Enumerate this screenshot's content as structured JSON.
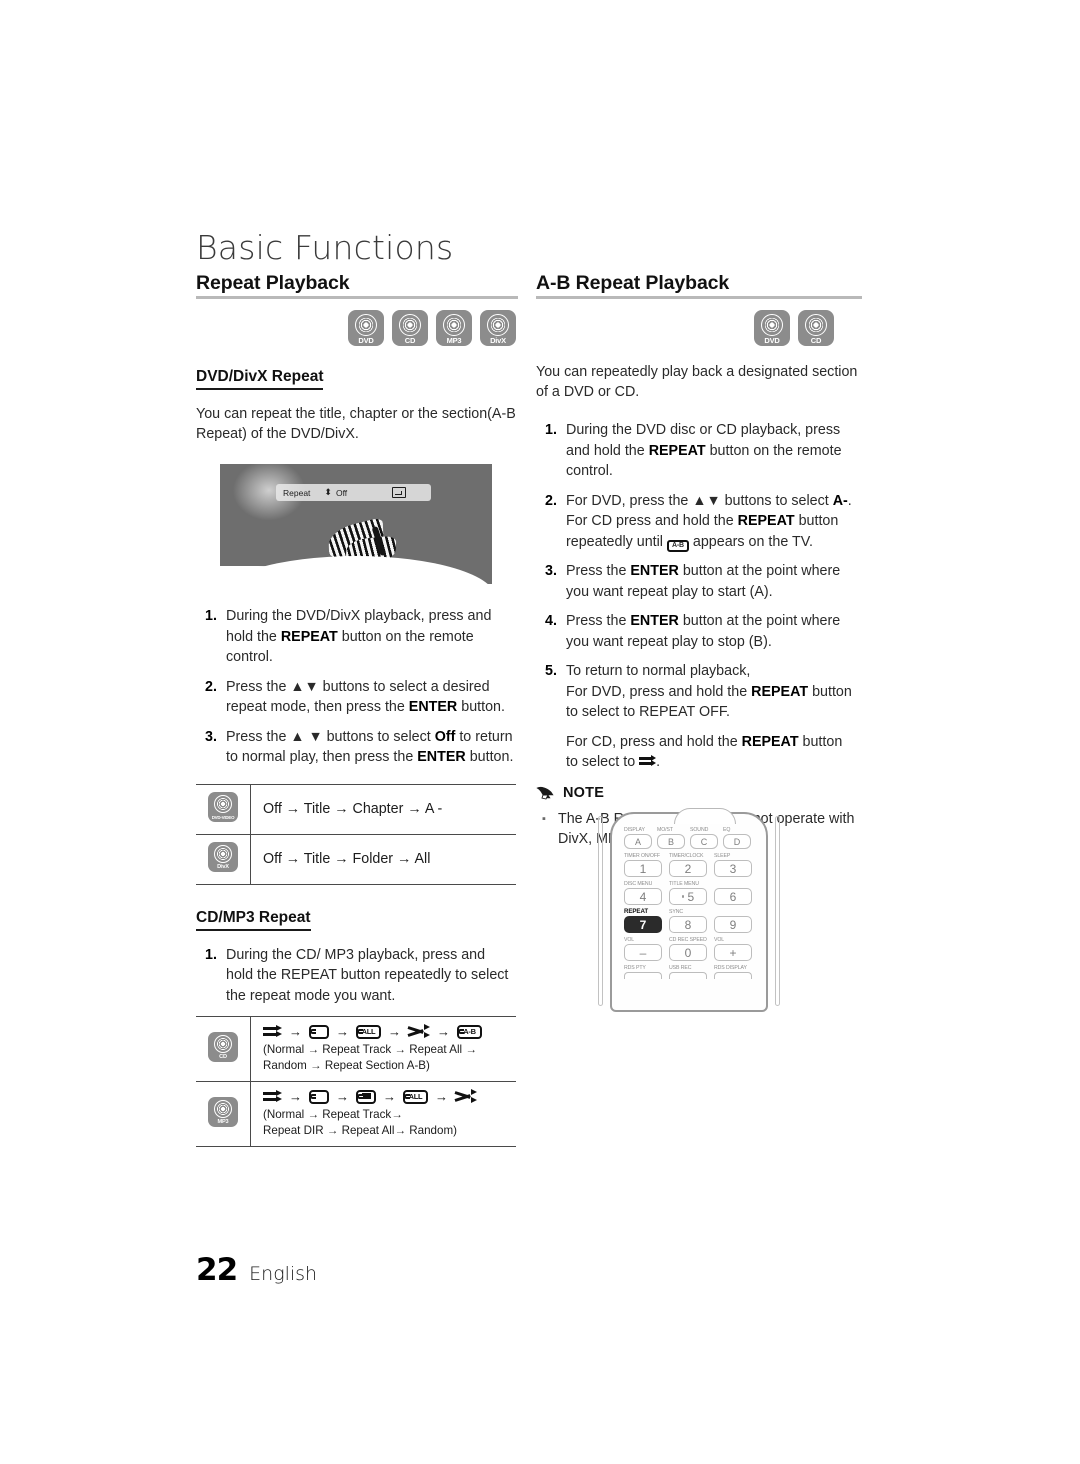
{
  "page": {
    "chapter_title": "Basic Functions",
    "number": "22",
    "language": "English"
  },
  "left_column": {
    "heading": "Repeat Playback",
    "disc_chips": [
      {
        "label": "DVD",
        "name": "dvd"
      },
      {
        "label": "CD",
        "name": "cd"
      },
      {
        "label": "MP3",
        "name": "mp3"
      },
      {
        "label": "DivX",
        "name": "divx"
      }
    ],
    "dvd_divx": {
      "sub_heading": "DVD/DivX Repeat",
      "intro": "You can repeat the title, chapter or the section(A-B Repeat) of the DVD/DivX.",
      "osd": {
        "label": "Repeat",
        "updown_glyph": "⬍",
        "value": "Off",
        "enter_icon": "enter-return-icon"
      },
      "steps": [
        {
          "num": "1.",
          "parts": [
            {
              "t": "During the DVD/DivX playback, press and hold the "
            },
            {
              "t": "REPEAT",
              "b": true
            },
            {
              "t": " button on the remote control."
            }
          ]
        },
        {
          "num": "2.",
          "parts": [
            {
              "t": "Press the "
            },
            {
              "t": "▲▼",
              "b": false
            },
            {
              "t": " buttons to select a desired repeat mode, then press the "
            },
            {
              "t": "ENTER",
              "b": true
            },
            {
              "t": " button."
            }
          ]
        },
        {
          "num": "3.",
          "parts": [
            {
              "t": "Press the "
            },
            {
              "t": "▲ ▼",
              "b": false
            },
            {
              "t": " buttons to select "
            },
            {
              "t": "Off",
              "b": true
            },
            {
              "t": " to return to normal play, then press the "
            },
            {
              "t": "ENTER",
              "b": true
            },
            {
              "t": " button."
            }
          ]
        }
      ],
      "mode_rows": [
        {
          "chip": "DVD-VIDEO",
          "text": "Off → Title → Chapter → A -"
        },
        {
          "chip": "DivX",
          "text": "Off → Title → Folder → All"
        }
      ]
    },
    "cd_mp3": {
      "sub_heading": "CD/MP3 Repeat",
      "steps": [
        {
          "num": "1.",
          "parts": [
            {
              "t": "During the CD/ MP3 playback, press and hold the REPEAT button repeatedly to select the repeat mode you want."
            }
          ]
        }
      ],
      "mode_rows": [
        {
          "chip": "CD",
          "icons": [
            "normal-icon",
            "repeat-track-icon",
            "repeat-all-icon",
            "shuffle-icon",
            "repeat-ab-icon"
          ],
          "icon_labels": [
            "",
            "",
            "ALL",
            "",
            "A-B"
          ],
          "caption_line1": "(Normal → Repeat Track → Repeat All →",
          "caption_line2": "Random → Repeat Section A-B)"
        },
        {
          "chip": "MP3",
          "icons": [
            "normal-icon",
            "repeat-track-icon",
            "repeat-dir-icon",
            "repeat-all-icon",
            "shuffle-icon"
          ],
          "icon_labels": [
            "",
            "",
            "",
            "ALL",
            ""
          ],
          "caption_line1": "(Normal  → Repeat Track→",
          "caption_line2": "Repeat DIR → Repeat All→ Random)"
        }
      ]
    }
  },
  "right_column": {
    "heading": "A-B Repeat Playback",
    "disc_chips": [
      {
        "label": "DVD",
        "name": "dvd"
      },
      {
        "label": "CD",
        "name": "cd"
      }
    ],
    "intro": "You can repeatedly play back a designated section of a DVD or CD.",
    "steps": [
      {
        "num": "1.",
        "parts": [
          {
            "t": "During the DVD disc or CD playback, press and hold the "
          },
          {
            "t": "REPEAT",
            "b": true
          },
          {
            "t": " button on the remote control."
          }
        ]
      },
      {
        "num": "2.",
        "parts": [
          {
            "t": "For DVD, press the "
          },
          {
            "t": "▲▼",
            "b": false
          },
          {
            "t": " buttons to select "
          },
          {
            "t": "A-",
            "b": true
          },
          {
            "t": ".\nFor CD press and hold the "
          },
          {
            "t": "REPEAT",
            "b": true
          },
          {
            "t": " button repeatedly until "
          },
          {
            "t": "[AB]",
            "icon": "repeat-ab-icon"
          },
          {
            "t": " appears on the TV."
          }
        ]
      },
      {
        "num": "3.",
        "parts": [
          {
            "t": "Press the "
          },
          {
            "t": "ENTER",
            "b": true
          },
          {
            "t": " button at the point where you want repeat play to start (A)."
          }
        ]
      },
      {
        "num": "4.",
        "parts": [
          {
            "t": "Press the "
          },
          {
            "t": "ENTER",
            "b": true
          },
          {
            "t": " button at the point where you want repeat play to stop (B)."
          }
        ]
      },
      {
        "num": "5.",
        "parts": [
          {
            "t": "To return to normal playback,\nFor DVD, press and hold the "
          },
          {
            "t": "REPEAT",
            "b": true
          },
          {
            "t": " button to select to REPEAT OFF."
          }
        ],
        "extra_parts": [
          {
            "t": "For CD, press and hold the "
          },
          {
            "t": "REPEAT",
            "b": true
          },
          {
            "t": " button to select to "
          },
          {
            "t": "[normal]",
            "icon": "normal-icon"
          },
          {
            "t": "."
          }
        ]
      }
    ],
    "note": {
      "icon": "pencil-note-icon",
      "title": "NOTE",
      "items": [
        "The A-B Repeat function does not operate with DivX, MP3 or JPEG discs."
      ]
    },
    "remote": {
      "rows": [
        {
          "keys": [
            {
              "cap": "DISPLAY",
              "label": "A",
              "type": "letter"
            },
            {
              "cap": "MO/ST",
              "label": "B",
              "type": "letter"
            },
            {
              "cap": "SOUND",
              "label": "C",
              "type": "letter"
            },
            {
              "cap": "EQ",
              "label": "D",
              "type": "letter"
            }
          ]
        },
        {
          "keys": [
            {
              "cap": "TIMER ON/OFF",
              "label": "1"
            },
            {
              "cap": "TIMER/CLOCK",
              "label": "2"
            },
            {
              "cap": "SLEEP",
              "label": "3"
            }
          ]
        },
        {
          "keys": [
            {
              "cap": "DISC MENU",
              "label": "4"
            },
            {
              "cap": "TITLE MENU",
              "label": "5",
              "dot": true
            },
            {
              "cap": "",
              "label": "6"
            }
          ]
        },
        {
          "keys": [
            {
              "cap": "REPEAT",
              "label": "7",
              "highlight": true
            },
            {
              "cap": "SYNC",
              "label": "8"
            },
            {
              "cap": "",
              "label": "9"
            }
          ]
        },
        {
          "keys": [
            {
              "cap": "VOL",
              "label": "–"
            },
            {
              "cap": "CD REC SPEED",
              "label": "0"
            },
            {
              "cap": "VOL",
              "label": "+"
            }
          ]
        },
        {
          "keys": [
            {
              "cap": "RDS PTY",
              "label": "",
              "stub": true
            },
            {
              "cap": "USB REC",
              "label": "",
              "stub": true
            },
            {
              "cap": "RDS DISPLAY",
              "label": "",
              "stub": true
            }
          ]
        }
      ]
    }
  }
}
